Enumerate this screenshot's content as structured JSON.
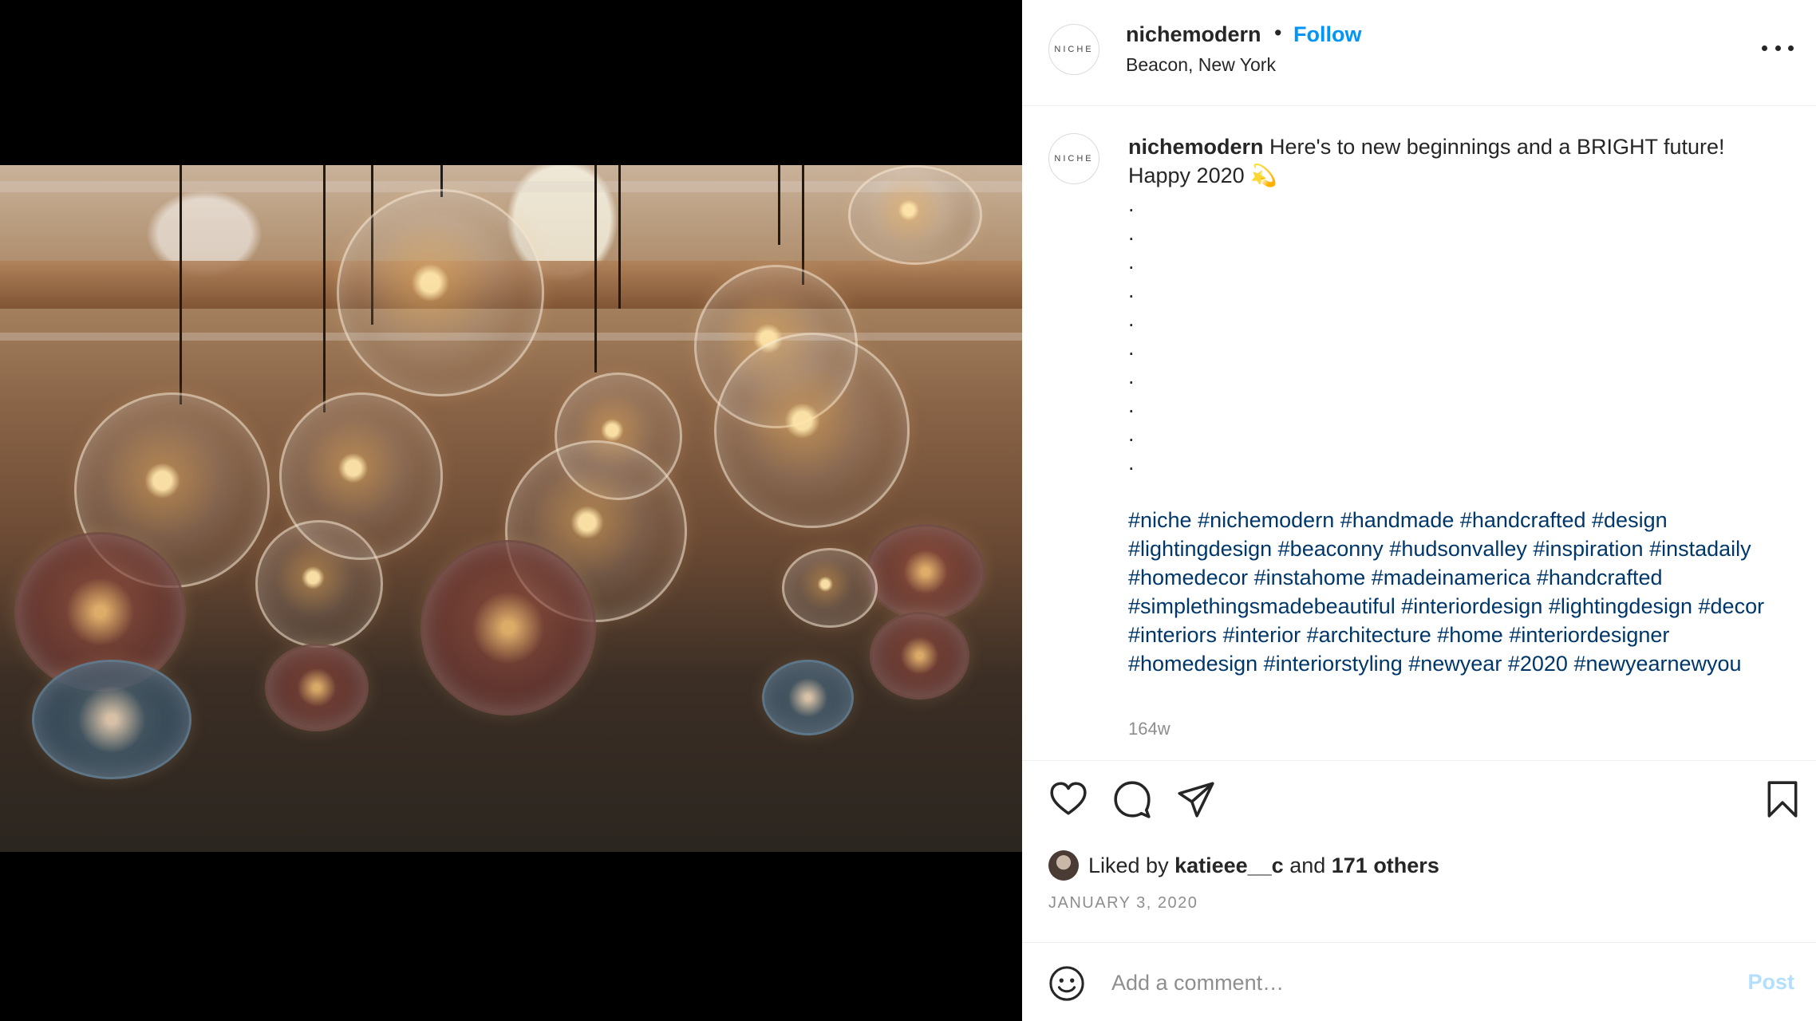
{
  "post": {
    "avatar_text": "NICHE",
    "username": "nichemodern",
    "separator": "•",
    "follow_label": "Follow",
    "location": "Beacon, New York",
    "caption_username": "nichemodern",
    "caption_text": " Here's to new beginnings and a BRIGHT future! Happy 2020 💫",
    "dots": [
      ".",
      ".",
      ".",
      ".",
      ".",
      ".",
      ".",
      ".",
      ".",
      "."
    ],
    "hashtags": [
      "#niche",
      "#nichemodern",
      "#handmade",
      "#handcrafted",
      "#design",
      "#lightingdesign",
      "#beaconny",
      "#hudsonvalley",
      "#inspiration",
      "#instadaily",
      "#homedecor",
      "#instahome",
      "#madeinamerica",
      "#handcrafted",
      "#simplethingsmadebeautiful",
      "#interiordesign",
      "#lightingdesign",
      "#decor",
      "#interiors",
      "#interior",
      "#architecture",
      "#home",
      "#interiordesigner",
      "#homedesign",
      "#interiorstyling",
      "#newyear",
      "#2020",
      "#newyearnewyou"
    ],
    "time_ago": "164w",
    "liked_prefix": "Liked by ",
    "liked_user": "katieee__c",
    "liked_and": " and ",
    "liked_others": "171 others",
    "date": "JANUARY 3, 2020"
  },
  "comment": {
    "placeholder": "Add a comment…",
    "post_label": "Post"
  },
  "colors": {
    "accent": "#0095f6",
    "hashtag": "#00376b",
    "muted": "#8e8e8e",
    "post_disabled": "#b2dffc"
  },
  "icons": {
    "like": "heart-icon",
    "comment": "comment-bubble-icon",
    "share": "paper-plane-icon",
    "save": "bookmark-icon",
    "more": "more-options-icon",
    "emoji": "emoji-icon"
  }
}
